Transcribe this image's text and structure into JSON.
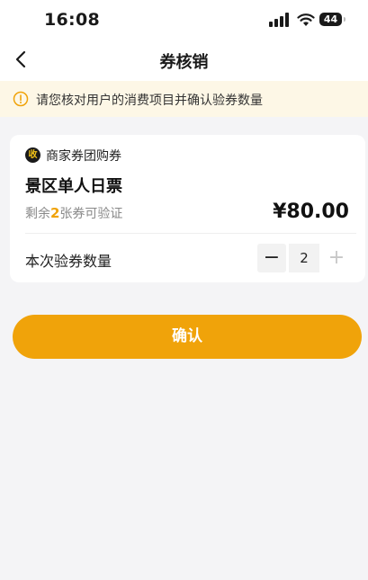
{
  "status_bar": {
    "time": "16:08",
    "battery": "44"
  },
  "nav": {
    "back_icon": "chevron-left-icon",
    "title": "券核销"
  },
  "notice": {
    "icon": "alert-circle-icon",
    "text": "请您核对用户的消费项目并确认验券数量"
  },
  "voucher": {
    "badge_icon_char": "收",
    "badge_label": "商家券团购券",
    "name": "景区单人日票",
    "remain_prefix": "剩余",
    "remain_count": "2",
    "remain_suffix": "张券可验证",
    "price": "¥80.00"
  },
  "quantity": {
    "label": "本次验券数量",
    "minus": "−",
    "value": "2",
    "plus": "+"
  },
  "confirm": {
    "label": "确认"
  },
  "colors": {
    "accent": "#f0a30a",
    "notice_bg": "#fdf7e6",
    "page_bg": "#f4f4f6"
  }
}
